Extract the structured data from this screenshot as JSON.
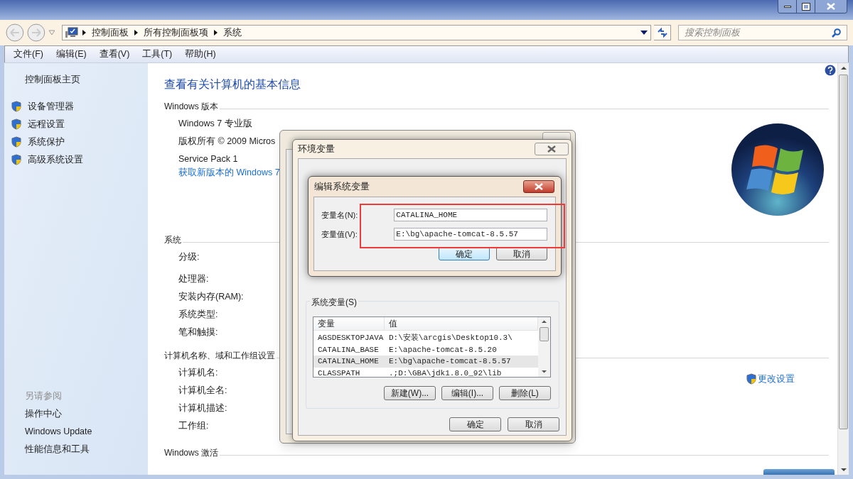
{
  "address_bar": {
    "breadcrumbs": [
      "控制面板",
      "所有控制面板项",
      "系统"
    ]
  },
  "search": {
    "placeholder": "搜索控制面板"
  },
  "menu": [
    "文件(F)",
    "编辑(E)",
    "查看(V)",
    "工具(T)",
    "帮助(H)"
  ],
  "sidebar": {
    "home": "控制面板主页",
    "tasks": [
      "设备管理器",
      "远程设置",
      "系统保护",
      "高级系统设置"
    ],
    "see_also_heading": "另请参阅",
    "see_also": [
      "操作中心",
      "Windows Update",
      "性能信息和工具"
    ]
  },
  "content": {
    "title": "查看有关计算机的基本信息",
    "sections": [
      {
        "heading": "Windows 版本",
        "rows": [
          {
            "kind": "text",
            "text": "Windows 7 专业版"
          },
          {
            "kind": "text",
            "text": "版权所有 © 2009 Micros"
          },
          {
            "kind": "text",
            "text": "Service Pack 1"
          },
          {
            "kind": "link",
            "text": "获取新版本的 Windows 7"
          }
        ]
      },
      {
        "heading": "系统",
        "rows": [
          {
            "kind": "text",
            "text": "分级:"
          },
          {
            "kind": "gap"
          },
          {
            "kind": "text",
            "text": "处理器:"
          },
          {
            "kind": "text",
            "text": "安装内存(RAM):"
          },
          {
            "kind": "text",
            "text": "系统类型:"
          },
          {
            "kind": "text",
            "text": "笔和触摸:"
          }
        ]
      },
      {
        "heading": "计算机名称、域和工作组设置",
        "rows": [
          {
            "kind": "text",
            "text": "计算机名:"
          },
          {
            "kind": "text",
            "text": "计算机全名:"
          },
          {
            "kind": "text",
            "text": "计算机描述:"
          },
          {
            "kind": "text",
            "text": "工作组:"
          }
        ],
        "action": "更改设置"
      },
      {
        "heading": "Windows 激活"
      }
    ]
  },
  "env_dialog": {
    "title": "环境变量",
    "group": "系统变量(S)",
    "columns": [
      "变量",
      "值"
    ],
    "rows": [
      {
        "name": "AGSDESKTOPJAVA",
        "value": "D:\\安装\\arcgis\\Desktop10.3\\",
        "selected": false
      },
      {
        "name": "CATALINA_BASE",
        "value": "E:\\apache-tomcat-8.5.20",
        "selected": false
      },
      {
        "name": "CATALINA_HOME",
        "value": "E:\\bg\\apache-tomcat-8.5.57",
        "selected": true
      },
      {
        "name": "CLASSPATH",
        "value": ".;D:\\GBA\\jdk1.8.0_92\\lib",
        "selected": false
      }
    ],
    "list_buttons": [
      "新建(W)...",
      "编辑(I)...",
      "删除(L)"
    ],
    "buttons": [
      "确定",
      "取消"
    ]
  },
  "edit_dialog": {
    "title": "编辑系统变量",
    "fields": [
      {
        "label": "变量名(N):",
        "value": "CATALINA_HOME"
      },
      {
        "label": "变量值(V):",
        "value": "E:\\bg\\apache-tomcat-8.5.57"
      }
    ],
    "buttons": [
      {
        "label": "确定",
        "default": true
      },
      {
        "label": "取消",
        "default": false
      }
    ]
  }
}
